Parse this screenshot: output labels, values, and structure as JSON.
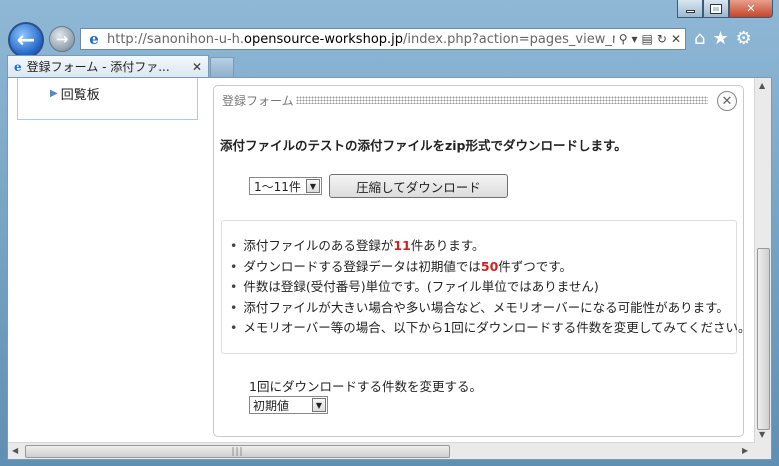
{
  "browser": {
    "url_prefix": "http://sanonihon-u-h.",
    "url_domain": "opensource-workshop.jp",
    "url_suffix": "/index.php?action=pages_view_main&",
    "tab_title": "登録フォーム - 添付ファ...",
    "back_glyph": "←",
    "forward_glyph": "→"
  },
  "sidebar": {
    "items": [
      {
        "label": "回覧板"
      }
    ]
  },
  "form": {
    "title": "登録フォーム",
    "headline": "添付ファイルのテストの添付ファイルをzip形式でダウンロードします。",
    "range_select_value": "1〜11件",
    "download_button_label": "圧縮してダウンロード",
    "notes": {
      "n1_before": "添付ファイルのある登録が",
      "n1_count": "11",
      "n1_after": "件あります。",
      "n2_before": "ダウンロードする登録データは初期値では",
      "n2_count": "50",
      "n2_after": "件ずつです。",
      "n3": "件数は登録(受付番号)単位です。(ファイル単位ではありません)",
      "n4": "添付ファイルが大きい場合や多い場合など、メモリオーバーになる可能性があります。",
      "n5": "メモリオーバー等の場合、以下から1回にダウンロードする件数を変更してみてください。"
    },
    "count_label": "1回にダウンロードする件数を変更する。",
    "count_select_value": "初期値"
  }
}
